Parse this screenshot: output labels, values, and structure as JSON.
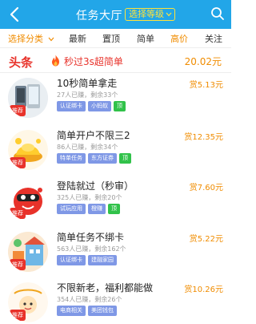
{
  "header": {
    "title": "任务大厅",
    "level_select": "选择等级",
    "background": "#22a6e8"
  },
  "tabs": [
    {
      "label": "选择分类",
      "active": true
    },
    {
      "label": "最新"
    },
    {
      "label": "置顶"
    },
    {
      "label": "简单"
    },
    {
      "label": "高价"
    },
    {
      "label": "关注"
    }
  ],
  "banner": {
    "badge": "头条",
    "text": "秒过3s超简单",
    "price": "20.02元"
  },
  "tasks": [
    {
      "title": "10秒简单拿走",
      "reward": "赏5.13元",
      "meta": "27人已赚，剩余33个",
      "tags": [
        "认证绑卡",
        "小蚂蚁",
        "顶"
      ],
      "flag": "推荐",
      "icon": "phones-icon"
    },
    {
      "title": "简单开户不限三2",
      "reward": "赏12.35元",
      "meta": "86人已赚，剩余34个",
      "tags": [
        "特单任务",
        "东方证券",
        "顶"
      ],
      "flag": "推荐",
      "icon": "gold-ingot-icon"
    },
    {
      "title": "登陆就过（秒审）",
      "reward": "赏7.60元",
      "meta": "325人已赚，剩余20个",
      "tags": [
        "试玩应用",
        "橙赚",
        "顶"
      ],
      "flag": "推荐",
      "icon": "red-mascot-icon"
    },
    {
      "title": "简单任务不绑卡",
      "reward": "赏5.22元",
      "meta": "563人已赚，剩余162个",
      "tags": [
        "认证绑卡",
        "建融家园"
      ],
      "flag": "推荐",
      "icon": "house-icon"
    },
    {
      "title": "不限新老，福利都能做",
      "reward": "赏10.26元",
      "meta": "354人已赚，剩余26个",
      "tags": [
        "电商相关",
        "美团钱包"
      ],
      "flag": "推荐",
      "icon": "cartoon-icon"
    }
  ],
  "colors": {
    "accent": "#22a6e8",
    "price": "#f08c00",
    "hot": "#e8322a",
    "tag": "#7f98e6",
    "tag_top": "#31c24a"
  }
}
